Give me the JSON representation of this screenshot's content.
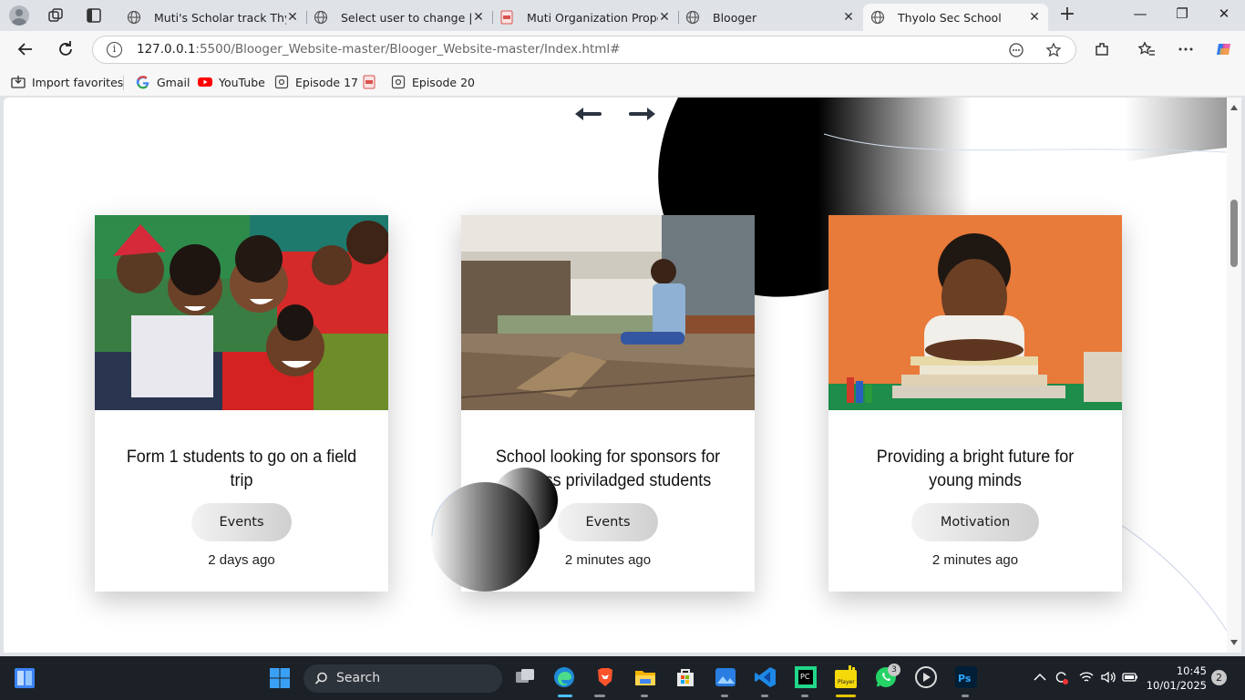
{
  "browser": {
    "tabs": [
      {
        "title": "Muti's Scholar track Thyolo",
        "icon": "globe-icon"
      },
      {
        "title": "Select user to change | Django",
        "icon": "globe-icon"
      },
      {
        "title": "Muti Organization Proposal",
        "icon": "pdf-icon"
      },
      {
        "title": "Blooger",
        "icon": "globe-icon"
      },
      {
        "title": "Thyolo Sec School",
        "icon": "globe-icon",
        "active": true
      }
    ],
    "url_host": "127.0.0.1",
    "url_path": ":5500/Blooger_Website-master/Blooger_Website-master/Index.html#",
    "favorites": [
      {
        "label": "Import favorites",
        "icon": "import-icon"
      },
      {
        "label": "Gmail",
        "icon": "google-icon"
      },
      {
        "label": "YouTube",
        "icon": "youtube-icon"
      },
      {
        "label": "Episode 17",
        "icon": "screen-icon"
      },
      {
        "label": "",
        "icon": "pdf-icon"
      },
      {
        "label": "Episode 20",
        "icon": "screen-icon"
      }
    ]
  },
  "page": {
    "cards": [
      {
        "title": "Form 1 students to go on a field trip",
        "category": "Events",
        "time": "2 days ago",
        "image": "group-of-smiling-children"
      },
      {
        "title": "School looking for sponsors for the less priviladged students",
        "category": "Events",
        "time": "2 minutes ago",
        "image": "boy-sitting-on-dock"
      },
      {
        "title": "Providing a bright future for young minds",
        "category": "Motivation",
        "time": "2 minutes ago",
        "image": "child-with-books"
      }
    ],
    "colors": {
      "accent_dark": "#000000",
      "pill_light": "#f3f3f3",
      "pill_dark": "#cfcfcf"
    }
  },
  "taskbar": {
    "search_label": "Search",
    "clock_time": "10:45",
    "clock_date": "10/01/2025",
    "notification_count": "2",
    "whatsapp_badge": "3"
  }
}
